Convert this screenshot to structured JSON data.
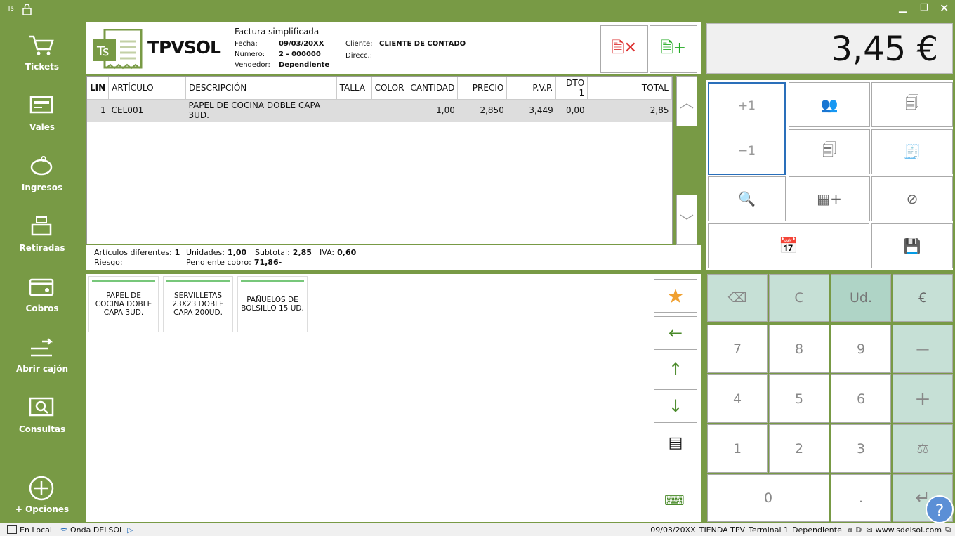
{
  "window": {
    "app_icon": "Ts",
    "lock_icon": "lock-icon",
    "controls": [
      "minimize",
      "restore",
      "close"
    ]
  },
  "sidebar": {
    "items": [
      {
        "label": "Tickets",
        "icon": "cart-icon"
      },
      {
        "label": "Vales",
        "icon": "voucher-icon"
      },
      {
        "label": "Ingresos",
        "icon": "piggy-bank-icon"
      },
      {
        "label": "Retiradas",
        "icon": "cash-register-icon"
      },
      {
        "label": "Cobros",
        "icon": "card-icon"
      },
      {
        "label": "Abrir cajón",
        "icon": "open-drawer-icon"
      },
      {
        "label": "Consultas",
        "icon": "search-icon"
      },
      {
        "label": "+ Opciones",
        "icon": "plus-circle-icon"
      }
    ]
  },
  "header": {
    "logo_text": "TPVSOL",
    "logo_badge": "Ts",
    "doc_type": "Factura simplificada",
    "fecha_label": "Fecha:",
    "fecha": "09/03/20XX",
    "numero_label": "Número:",
    "numero": "2 - 000000",
    "vendedor_label": "Vendedor:",
    "vendedor": "Dependiente",
    "cliente_label": "Cliente:",
    "cliente": "CLIENTE DE CONTADO",
    "direcc_label": "Direcc.:",
    "direcc": ""
  },
  "table": {
    "columns": [
      "LIN",
      "ARTÍCULO",
      "DESCRIPCIÓN",
      "TALLA",
      "COLOR",
      "CANTIDAD",
      "PRECIO",
      "P.V.P.",
      "DTO 1",
      "TOTAL"
    ],
    "rows": [
      {
        "lin": "1",
        "articulo": "CEL001",
        "descripcion": "PAPEL DE COCINA DOBLE CAPA 3UD.",
        "talla": "",
        "color": "",
        "cantidad": "1,00",
        "precio": "2,850",
        "pvp": "3,449",
        "dto": "0,00",
        "total": "2,85"
      }
    ]
  },
  "summary": {
    "articulos_label": "Artículos diferentes:",
    "articulos": "1",
    "unidades_label": "Unidades:",
    "unidades": "1,00",
    "subtotal_label": "Subtotal:",
    "subtotal": "2,85",
    "iva_label": "IVA:",
    "iva": "0,60",
    "riesgo_label": "Riesgo:",
    "pendiente_label": "Pendiente cobro:",
    "pendiente": "71,86-"
  },
  "products": [
    "PAPEL DE COCINA DOBLE CAPA 3UD.",
    "SERVILLETAS 23X23 DOBLE CAPA 200UD.",
    "PAÑUELOS DE BOLSILLO 15 UD."
  ],
  "total_display": "3,45 €",
  "qty": {
    "plus": "+1",
    "minus": "−1"
  },
  "keypad": {
    "clear": "C",
    "units": "Ud.",
    "euro": "€",
    "minus": "—",
    "plus": "+",
    "keys": [
      "7",
      "8",
      "9",
      "4",
      "5",
      "6",
      "1",
      "2",
      "3",
      "0",
      "."
    ]
  },
  "status": {
    "local": "En Local",
    "radio": "Onda DELSOL",
    "date": "09/03/20XX",
    "store": "TIENDA TPV",
    "terminal": "Terminal 1",
    "user": "Dependiente",
    "web": "www.sdelsol.com"
  },
  "colors": {
    "brand_green": "#789a45",
    "keypad_green": "#c6e0d6",
    "keypad_active": "#afd4c6",
    "selection_blue": "#2a6fba"
  }
}
